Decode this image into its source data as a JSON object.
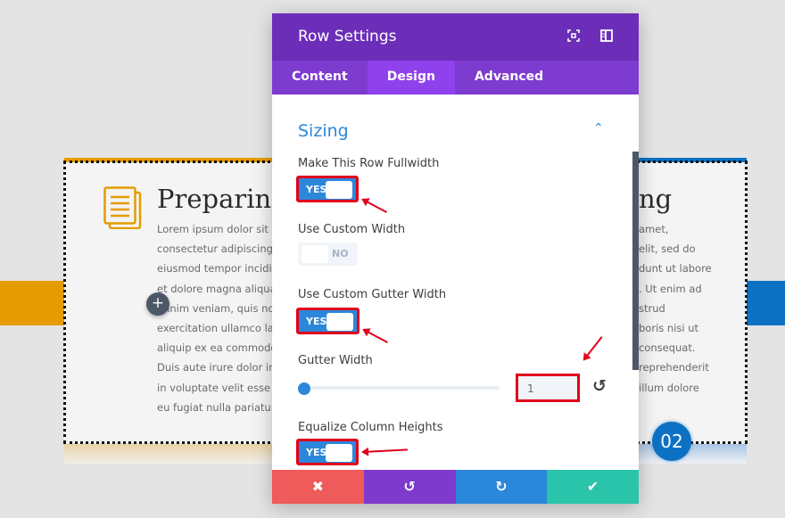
{
  "background": {
    "left_card": {
      "title": "Preparing",
      "lines": [
        "Lorem ipsum dolor sit amet,",
        "consectetur adipiscing elit, sed do",
        "eiusmod tempor incididunt ut labore",
        "et dolore magna aliqua. Ut enim ad",
        "minim veniam, quis nostrud",
        "exercitation ullamco laboris nisi ut",
        "aliquip ex ea commodo consequat.",
        "Duis aute irure dolor in reprehenderit",
        "in voluptate velit esse cillum dolore",
        "eu fugiat nulla pariatur."
      ]
    },
    "right_card": {
      "title": "ng",
      "lines": [
        "amet,",
        "elit, sed do",
        "dunt ut labore",
        ". Ut enim ad",
        "strud",
        "boris nisi ut",
        " consequat.",
        " reprehenderit",
        "illum dolore"
      ]
    },
    "add_button": "+",
    "step_badge": "02"
  },
  "modal": {
    "title": "Row Settings",
    "tabs": [
      {
        "label": "Content"
      },
      {
        "label": "Design",
        "active": true
      },
      {
        "label": "Advanced"
      }
    ],
    "section": "Sizing",
    "fields": {
      "fullwidth": {
        "label": "Make This Row Fullwidth",
        "value": "YES"
      },
      "custom_width": {
        "label": "Use Custom Width",
        "value": "NO"
      },
      "custom_gutter": {
        "label": "Use Custom Gutter Width",
        "value": "YES"
      },
      "gutter_width": {
        "label": "Gutter Width",
        "value": "1"
      },
      "equalize": {
        "label": "Equalize Column Heights",
        "value": "YES"
      }
    },
    "footer": {
      "cancel": "✖",
      "undo": "↺",
      "redo": "↻",
      "save": "✔"
    }
  },
  "colors": {
    "header": "#6c2eb9",
    "accent": "#2b87da",
    "cancel": "#ef5a5a",
    "undo": "#7d3acb",
    "redo": "#2b87da",
    "save": "#29c4a9",
    "highlight": "#e0001b"
  }
}
